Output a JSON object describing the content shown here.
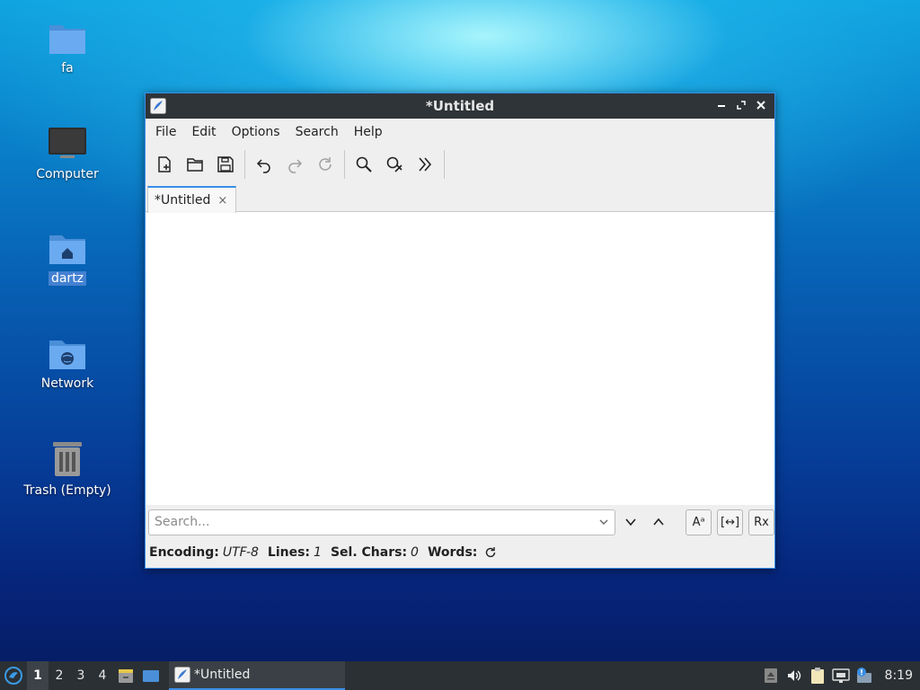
{
  "desktop": {
    "icons": [
      {
        "label": "fa"
      },
      {
        "label": "Computer"
      },
      {
        "label": "dartz"
      },
      {
        "label": "Network"
      },
      {
        "label": "Trash (Empty)"
      }
    ]
  },
  "window": {
    "title": "*Untitled",
    "menu": [
      "File",
      "Edit",
      "Options",
      "Search",
      "Help"
    ],
    "tab": {
      "label": "*Untitled",
      "close": "×"
    },
    "search": {
      "placeholder": "Search..."
    },
    "search_options": {
      "case": "Aᵃ",
      "whole_word": "[↔]",
      "regex": "Rx"
    },
    "status": {
      "encoding_label": "Encoding:",
      "encoding_value": "UTF-8",
      "lines_label": "Lines:",
      "lines_value": "1",
      "sel_label": "Sel. Chars:",
      "sel_value": "0",
      "words_label": "Words:"
    }
  },
  "taskbar": {
    "workspaces": [
      "1",
      "2",
      "3",
      "4"
    ],
    "active_workspace": "1",
    "task_label": "*Untitled",
    "clock": "8:19"
  },
  "colors": {
    "accent": "#3a8ee6",
    "titlebar": "#2f3438",
    "taskbar": "#2b3034"
  }
}
